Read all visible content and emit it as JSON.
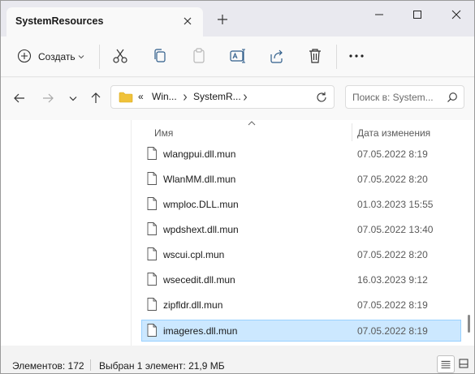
{
  "window": {
    "tab_title": "SystemResources"
  },
  "toolbar": {
    "create_label": "Создать",
    "icons": [
      "cut-icon",
      "copy-icon",
      "paste-icon",
      "rename-icon",
      "share-icon",
      "delete-icon",
      "more-icon"
    ]
  },
  "address": {
    "overflow": "«",
    "segments": [
      "Win...",
      "SystemR..."
    ]
  },
  "search": {
    "placeholder": "Поиск в: System..."
  },
  "columns": {
    "name": "Имя",
    "date": "Дата изменения"
  },
  "files": [
    {
      "name": "wlangpui.dll.mun",
      "date": "07.05.2022 8:19"
    },
    {
      "name": "WlanMM.dll.mun",
      "date": "07.05.2022 8:20"
    },
    {
      "name": "wmploc.DLL.mun",
      "date": "01.03.2023 15:55"
    },
    {
      "name": "wpdshext.dll.mun",
      "date": "07.05.2022 13:40"
    },
    {
      "name": "wscui.cpl.mun",
      "date": "07.05.2022 8:20"
    },
    {
      "name": "wsecedit.dll.mun",
      "date": "16.03.2023 9:12"
    },
    {
      "name": "zipfldr.dll.mun",
      "date": "07.05.2022 8:19"
    },
    {
      "name": "imageres.dll.mun",
      "date": "07.05.2022 8:19",
      "selected": true
    }
  ],
  "status": {
    "count": "Элементов: 172",
    "selection": "Выбран 1 элемент: 21,9 МБ"
  },
  "colors": {
    "selection_bg": "#cce8ff",
    "selection_border": "#99d1ff",
    "folder": "#f0c23a"
  }
}
